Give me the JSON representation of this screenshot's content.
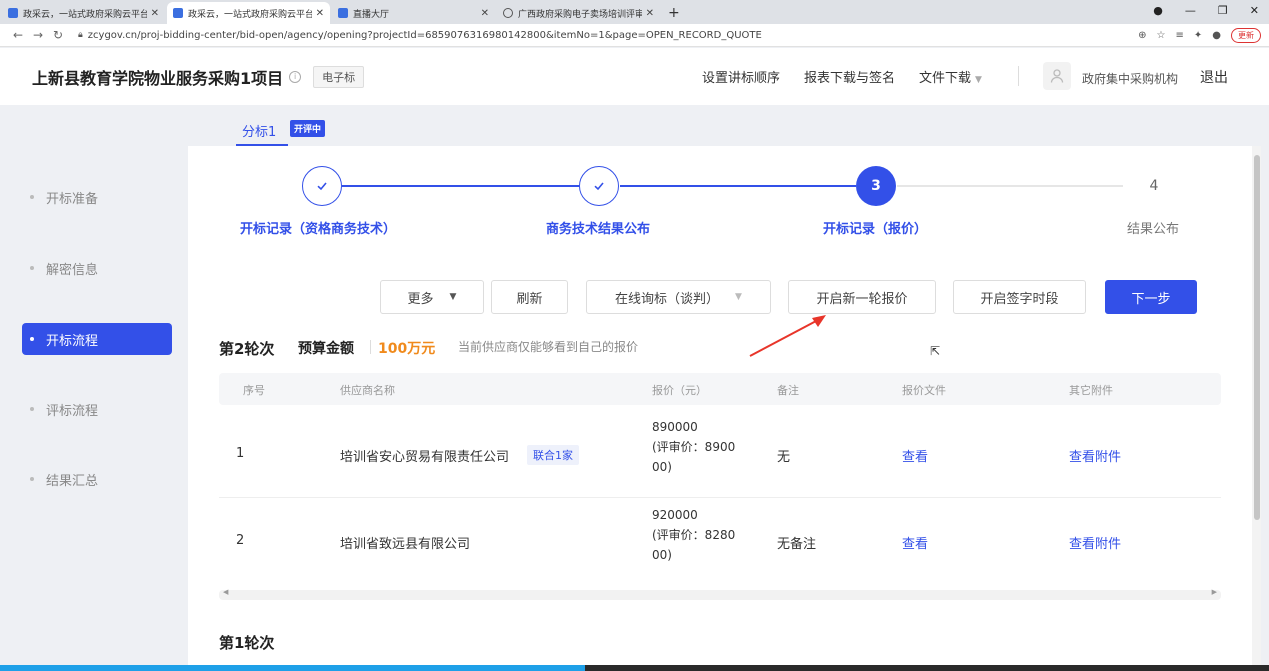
{
  "browser": {
    "tabs": [
      {
        "label": "政采云，一站式政府采购云平台",
        "close": "✕"
      },
      {
        "label": "政采云，一站式政府采购云平台",
        "close": "✕"
      },
      {
        "label": "直播大厅",
        "close": "✕"
      },
      {
        "label": "广西政府采购电子卖场培训评审专",
        "close": "✕"
      }
    ],
    "new_tab": "+",
    "url": "zcygov.cn/proj-bidding-center/bid-open/agency/opening?projectId=6859076316980142800&itemNo=1&page=OPEN_RECORD_QUOTE",
    "update_label": "更新",
    "window_controls": [
      "●",
      "—",
      "❐",
      "✕"
    ]
  },
  "header": {
    "project_title": "上新县教育学院物业服务采购1项目",
    "tag": "电子标",
    "menu": [
      {
        "label": "设置讲标顺序"
      },
      {
        "label": "报表下载与签名"
      },
      {
        "label": "文件下载"
      }
    ],
    "user_name": "政府集中采购机构",
    "logout": "退出"
  },
  "sidebar": {
    "items": [
      {
        "label": "开标准备"
      },
      {
        "label": "解密信息"
      },
      {
        "label": "开标流程"
      },
      {
        "label": "评标流程"
      },
      {
        "label": "结果汇总"
      }
    ],
    "active_index": 2
  },
  "subtab": {
    "label": "分标1",
    "badge": "开评中"
  },
  "steps": [
    {
      "number": "1",
      "label": "开标记录（资格商务技术）",
      "status": "done"
    },
    {
      "number": "2",
      "label": "商务技术结果公布",
      "status": "done"
    },
    {
      "number": "3",
      "label": "开标记录（报价）",
      "status": "current"
    },
    {
      "number": "4",
      "label": "结果公布",
      "status": "todo"
    }
  ],
  "toolbar": {
    "more": "更多",
    "refresh": "刷新",
    "online_inquiry": "在线询标（谈判）",
    "new_round": "开启新一轮报价",
    "sign_period": "开启签字时段",
    "next": "下一步"
  },
  "round2": {
    "title": "第2轮次",
    "budget_label": "预算金额",
    "budget_value": "100万元",
    "note": "当前供应商仅能够看到自己的报价"
  },
  "table": {
    "columns": [
      "序号",
      "供应商名称",
      "报价（元）",
      "备注",
      "报价文件",
      "其它附件"
    ],
    "rows": [
      {
        "index": "1",
        "supplier": "培训省安心贸易有限责任公司",
        "tag": "联合1家",
        "price_line1": "890000",
        "price_line2": "(评审价：8900",
        "price_line3": "00)",
        "remark": "无",
        "quote_file": "查看",
        "attachments": "查看附件"
      },
      {
        "index": "2",
        "supplier": "培训省致远县有限公司",
        "tag": "",
        "price_line1": "920000",
        "price_line2": "(评审价：8280",
        "price_line3": "00)",
        "remark": "无备注",
        "quote_file": "查看",
        "attachments": "查看附件"
      }
    ]
  },
  "round1": {
    "title": "第1轮次"
  },
  "colors": {
    "primary": "#3350e8",
    "budget": "#f08a1c",
    "annotation_arrow": "#e8352a"
  }
}
